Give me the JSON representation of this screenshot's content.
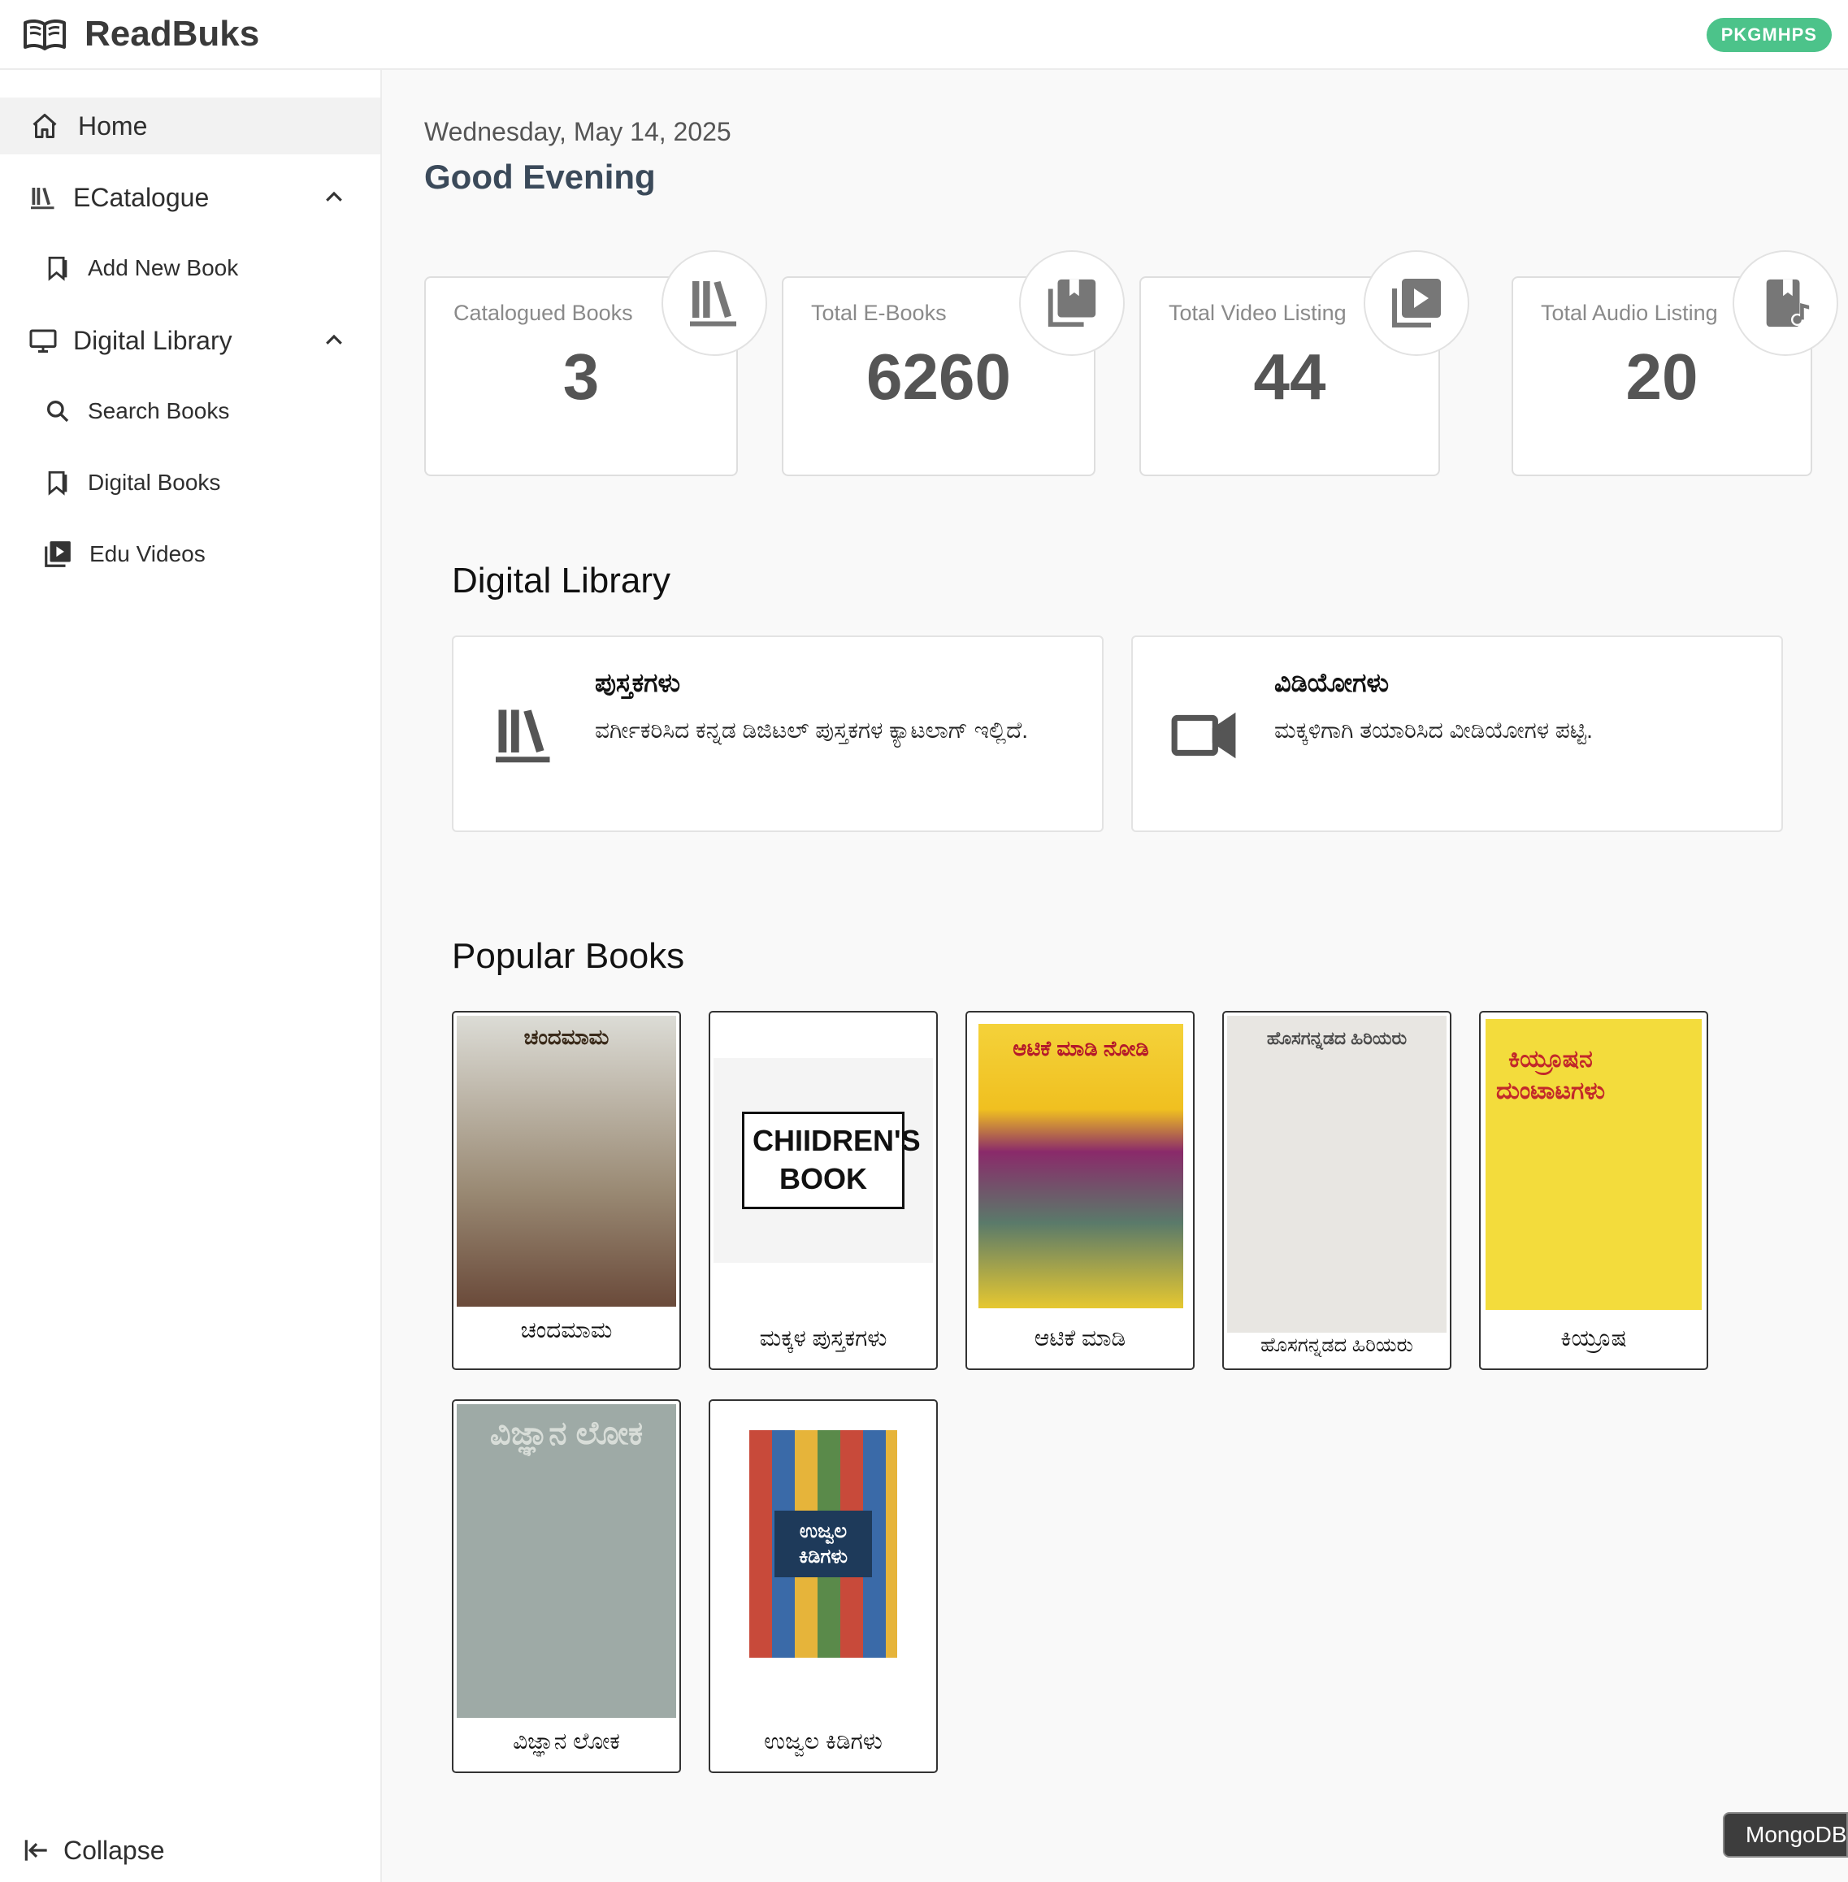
{
  "app": {
    "name": "ReadBuks",
    "badge": "PKGMHPS"
  },
  "sidebar": {
    "items": [
      {
        "label": "Home"
      },
      {
        "label": "ECatalogue"
      },
      {
        "label": "Add New Book"
      },
      {
        "label": "Digital Library"
      },
      {
        "label": "Search Books"
      },
      {
        "label": "Digital Books"
      },
      {
        "label": "Edu Videos"
      }
    ],
    "collapse_label": "Collapse"
  },
  "main": {
    "date": "Wednesday, May 14, 2025",
    "greeting": "Good Evening",
    "stats": [
      {
        "label": "Catalogued Books",
        "value": "3"
      },
      {
        "label": "Total E-Books",
        "value": "6260"
      },
      {
        "label": "Total Video Listing",
        "value": "44"
      },
      {
        "label": "Total Audio Listing",
        "value": "20"
      }
    ],
    "digital_library": {
      "title": "Digital Library",
      "cards": [
        {
          "title": "ಪುಸ್ತಕಗಳು",
          "desc": "ವರ್ಗೀಕರಿಸಿದ ಕನ್ನಡ ಡಿಜಿಟಲ್ ಪುಸ್ತಕಗಳ ಕ್ಯಾಟಲಾಗ್ ಇಲ್ಲಿದೆ."
        },
        {
          "title": "ವಿಡಿಯೋಗಳು",
          "desc": "ಮಕ್ಕಳಿಗಾಗಿ ತಯಾರಿಸಿದ ವೀಡಿಯೋಗಳ ಪಟ್ಟಿ."
        }
      ]
    },
    "popular_books": {
      "title": "Popular Books",
      "books": [
        {
          "title": "ಚಂದಮಾಮ",
          "cover_text": "ಚಂದಮಾಮ"
        },
        {
          "title": "ಮಕ್ಕಳ ಪುಸ್ತಕಗಳು",
          "cover_text": "CHIIDREN'S BOOK"
        },
        {
          "title": "ಆಟಿಕೆ ಮಾಡಿ",
          "cover_text": "ಆಟಿಕೆ ಮಾಡಿ ನೋಡಿ"
        },
        {
          "title": "ಹೊಸಗನ್ನಡದ ಹಿರಿಯರು",
          "cover_text": "ಹೊಸಗನ್ನಡದ ಹಿರಿಯರು"
        },
        {
          "title": "ಕಿಯ್ರೂಷ",
          "cover_text": "ಕಿಯ್ರೂಷನ ದುಂಟಾಟಗಳು"
        },
        {
          "title": "ವಿಜ್ಞಾನ ಲೋಕ",
          "cover_text": "ವಿಜ್ಞಾನ ಲೋಕ"
        },
        {
          "title": "ಉಜ್ವಲ ಕಿಡಿಗಳು",
          "cover_text": "ಉಜ್ವಲ ಕಿಡಿಗಳು"
        }
      ]
    }
  },
  "footer": {
    "mongo_label": "MongoDB"
  },
  "colors": {
    "badge": "#4cc38a",
    "icon_gray": "#777777",
    "greeting": "#3b4a5a"
  }
}
